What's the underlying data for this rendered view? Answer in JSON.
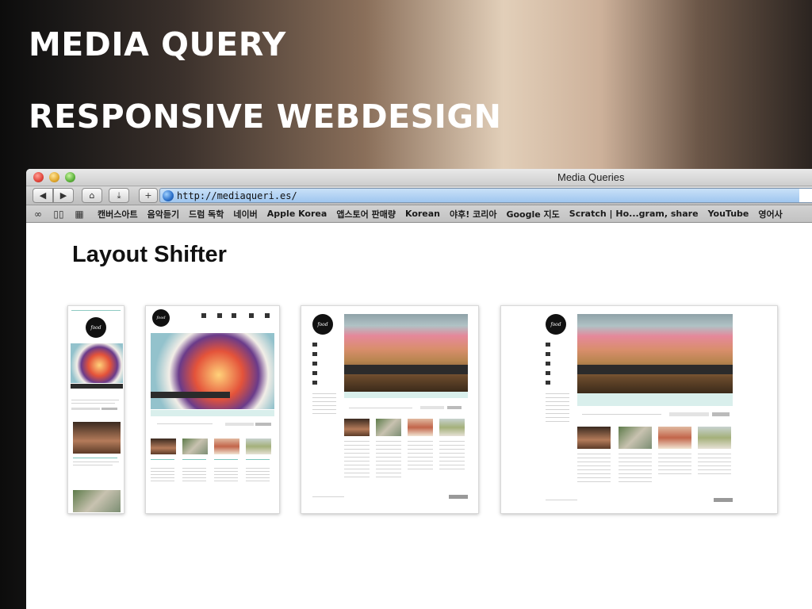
{
  "slide": {
    "title_line1": "MEDIA QUERY",
    "title_line2": "RESPONSIVE WEBDESIGN"
  },
  "window": {
    "title": "Media Queries",
    "url": "http://mediaqueri.es/",
    "toolbar": {
      "back_label": "◀",
      "forward_label": "▶",
      "home_label": "⌂",
      "download_label": "⤓",
      "add_label": "+"
    },
    "bookmarks": [
      "캔버스아트",
      "음악듣기",
      "드럼 독학",
      "네이버",
      "Apple Korea",
      "앱스토어 판매량",
      "Korean",
      "야후! 코리아",
      "Google 지도",
      "Scratch | Ho...gram, share",
      "YouTube",
      "영어사"
    ]
  },
  "page": {
    "heading": "Layout Shifter"
  },
  "colors": {
    "accent_teal": "#7cc5bd",
    "url_bar": "#9fc6ef"
  }
}
